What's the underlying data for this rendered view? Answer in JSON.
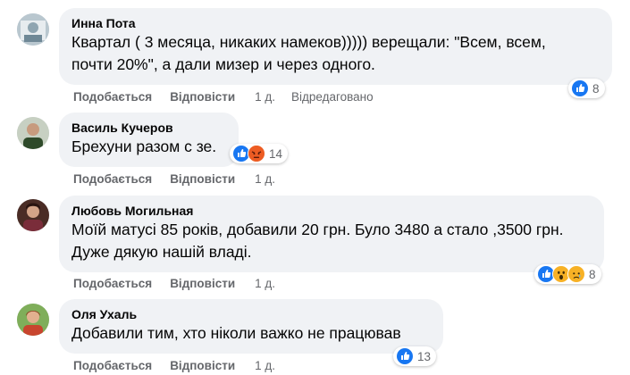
{
  "colors": {
    "like_blue": "#1877f2",
    "angry_red": "#e9710f",
    "bubble_bg": "#f0f2f5",
    "meta_gray": "#65676b"
  },
  "comments": [
    {
      "author": "Инна Пота",
      "lines": [
        "Квартал ( 3 месяца, никаких намеков))))) верещали: \"Всем, всем,",
        "почти 20%\", а дали мизер и через одного."
      ],
      "like_label": "Подобається",
      "reply_label": "Відповісти",
      "time": "1 д.",
      "edited": "Відредаговано",
      "reactions": [
        "like-icon"
      ],
      "reaction_count": "8"
    },
    {
      "author": "Василь Кучеров",
      "lines": [
        "Брехуни разом с зе."
      ],
      "like_label": "Подобається",
      "reply_label": "Відповісти",
      "time": "1 д.",
      "reactions": [
        "like-icon",
        "angry-icon"
      ],
      "reaction_count": "14"
    },
    {
      "author": "Любовь Могильная",
      "lines": [
        "Моїй матусі 85 років, добавили 20 грн. Було 3480 а стало ,3500 грн.",
        "Дуже дякую нашій владі."
      ],
      "like_label": "Подобається",
      "reply_label": "Відповісти",
      "time": "1 д.",
      "reactions": [
        "like-icon",
        "wow-icon",
        "sad-icon"
      ],
      "reaction_count": "8"
    },
    {
      "author": "Оля Ухаль",
      "lines": [
        "Добавили тим, хто ніколи важко не працював"
      ],
      "like_label": "Подобається",
      "reply_label": "Відповісти",
      "time": "1 д.",
      "reactions": [
        "like-icon"
      ],
      "reaction_count": "13"
    }
  ]
}
